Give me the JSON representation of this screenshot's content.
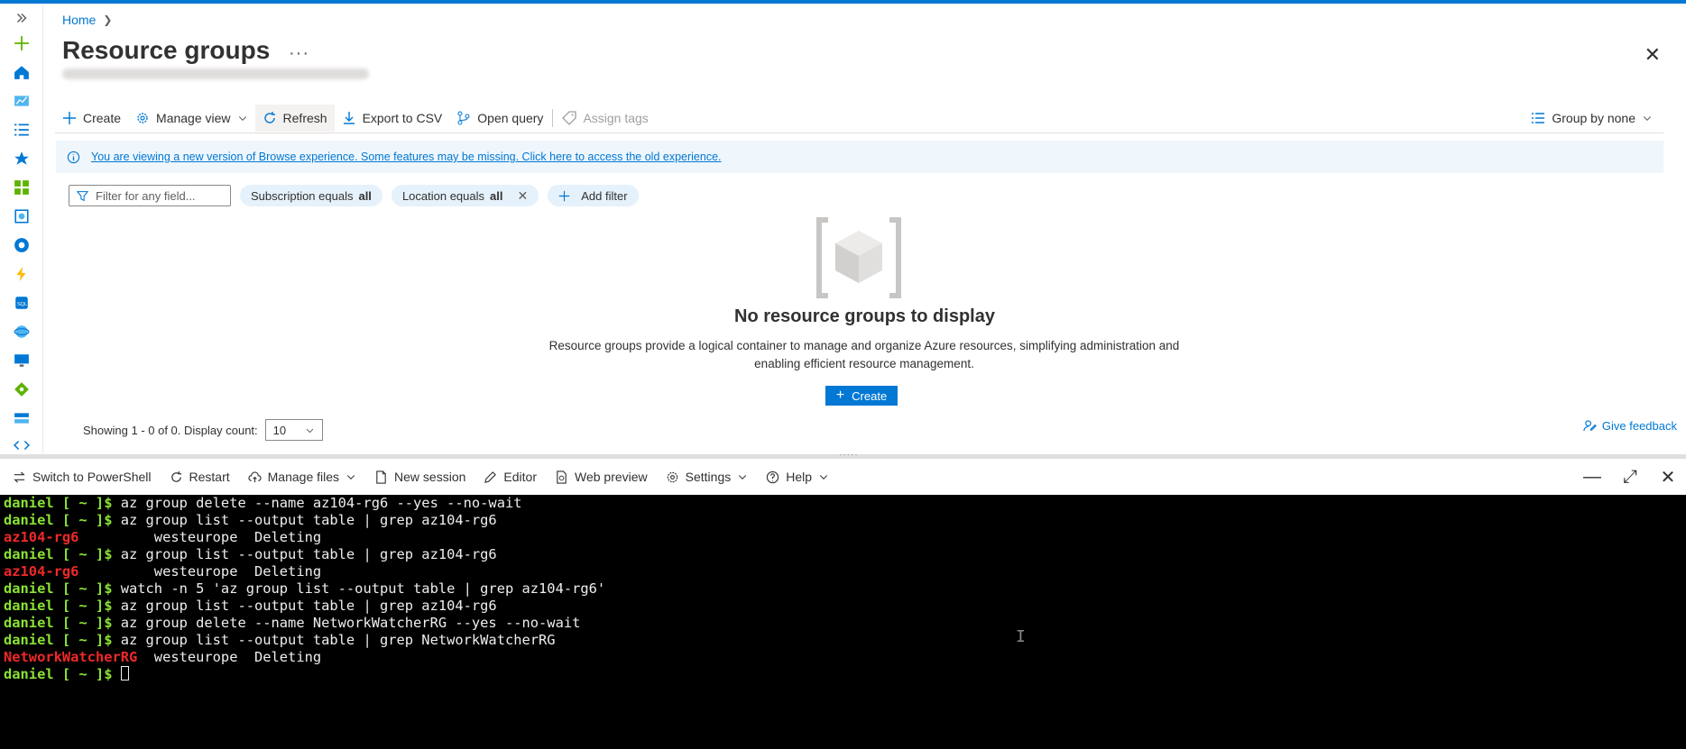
{
  "colors": {
    "accent": "#0078d4",
    "terminal_prompt": "#8ae234",
    "terminal_red": "#ef2929"
  },
  "breadcrumb": {
    "home": "Home"
  },
  "page": {
    "title": "Resource groups"
  },
  "toolbar": {
    "create": "Create",
    "manage_view": "Manage view",
    "refresh": "Refresh",
    "export_csv": "Export to CSV",
    "open_query": "Open query",
    "assign_tags": "Assign tags",
    "group_by": "Group by none"
  },
  "banner": {
    "text": "You are viewing a new version of Browse experience. Some features may be missing. Click here to access the old experience."
  },
  "filters": {
    "placeholder": "Filter for any field...",
    "subscription_prefix": "Subscription equals",
    "subscription_value": "all",
    "location_prefix": "Location equals",
    "location_value": "all",
    "add_filter": "Add filter"
  },
  "empty": {
    "title": "No resource groups to display",
    "desc1": "Resource groups provide a logical container to manage and organize Azure resources, simplifying administration and",
    "desc2": "enabling efficient resource management.",
    "create": "Create"
  },
  "footer": {
    "showing": "Showing 1 - 0 of 0. Display count:",
    "count": "10",
    "feedback": "Give feedback"
  },
  "shell": {
    "switch": "Switch to PowerShell",
    "restart": "Restart",
    "manage_files": "Manage files",
    "new_session": "New session",
    "editor": "Editor",
    "web_preview": "Web preview",
    "settings": "Settings",
    "help": "Help"
  },
  "terminal": {
    "prompt": "daniel [ ~ ]$ ",
    "lines": [
      {
        "type": "cmd",
        "text": "az group delete --name az104-rg6 --yes --no-wait"
      },
      {
        "type": "cmd",
        "text": "az group list --output table | grep az104-rg6"
      },
      {
        "type": "out",
        "name": "az104-rg6",
        "rest": "         westeurope  Deleting"
      },
      {
        "type": "cmd",
        "text": "az group list --output table | grep az104-rg6"
      },
      {
        "type": "out",
        "name": "az104-rg6",
        "rest": "         westeurope  Deleting"
      },
      {
        "type": "cmd",
        "text": "watch -n 5 'az group list --output table | grep az104-rg6'"
      },
      {
        "type": "cmd",
        "text": "az group list --output table | grep az104-rg6"
      },
      {
        "type": "cmd",
        "text": "az group delete --name NetworkWatcherRG --yes --no-wait"
      },
      {
        "type": "cmd",
        "text": "az group list --output table | grep NetworkWatcherRG"
      },
      {
        "type": "out",
        "name": "NetworkWatcherRG",
        "rest": "  westeurope  Deleting"
      },
      {
        "type": "cursor"
      }
    ]
  }
}
